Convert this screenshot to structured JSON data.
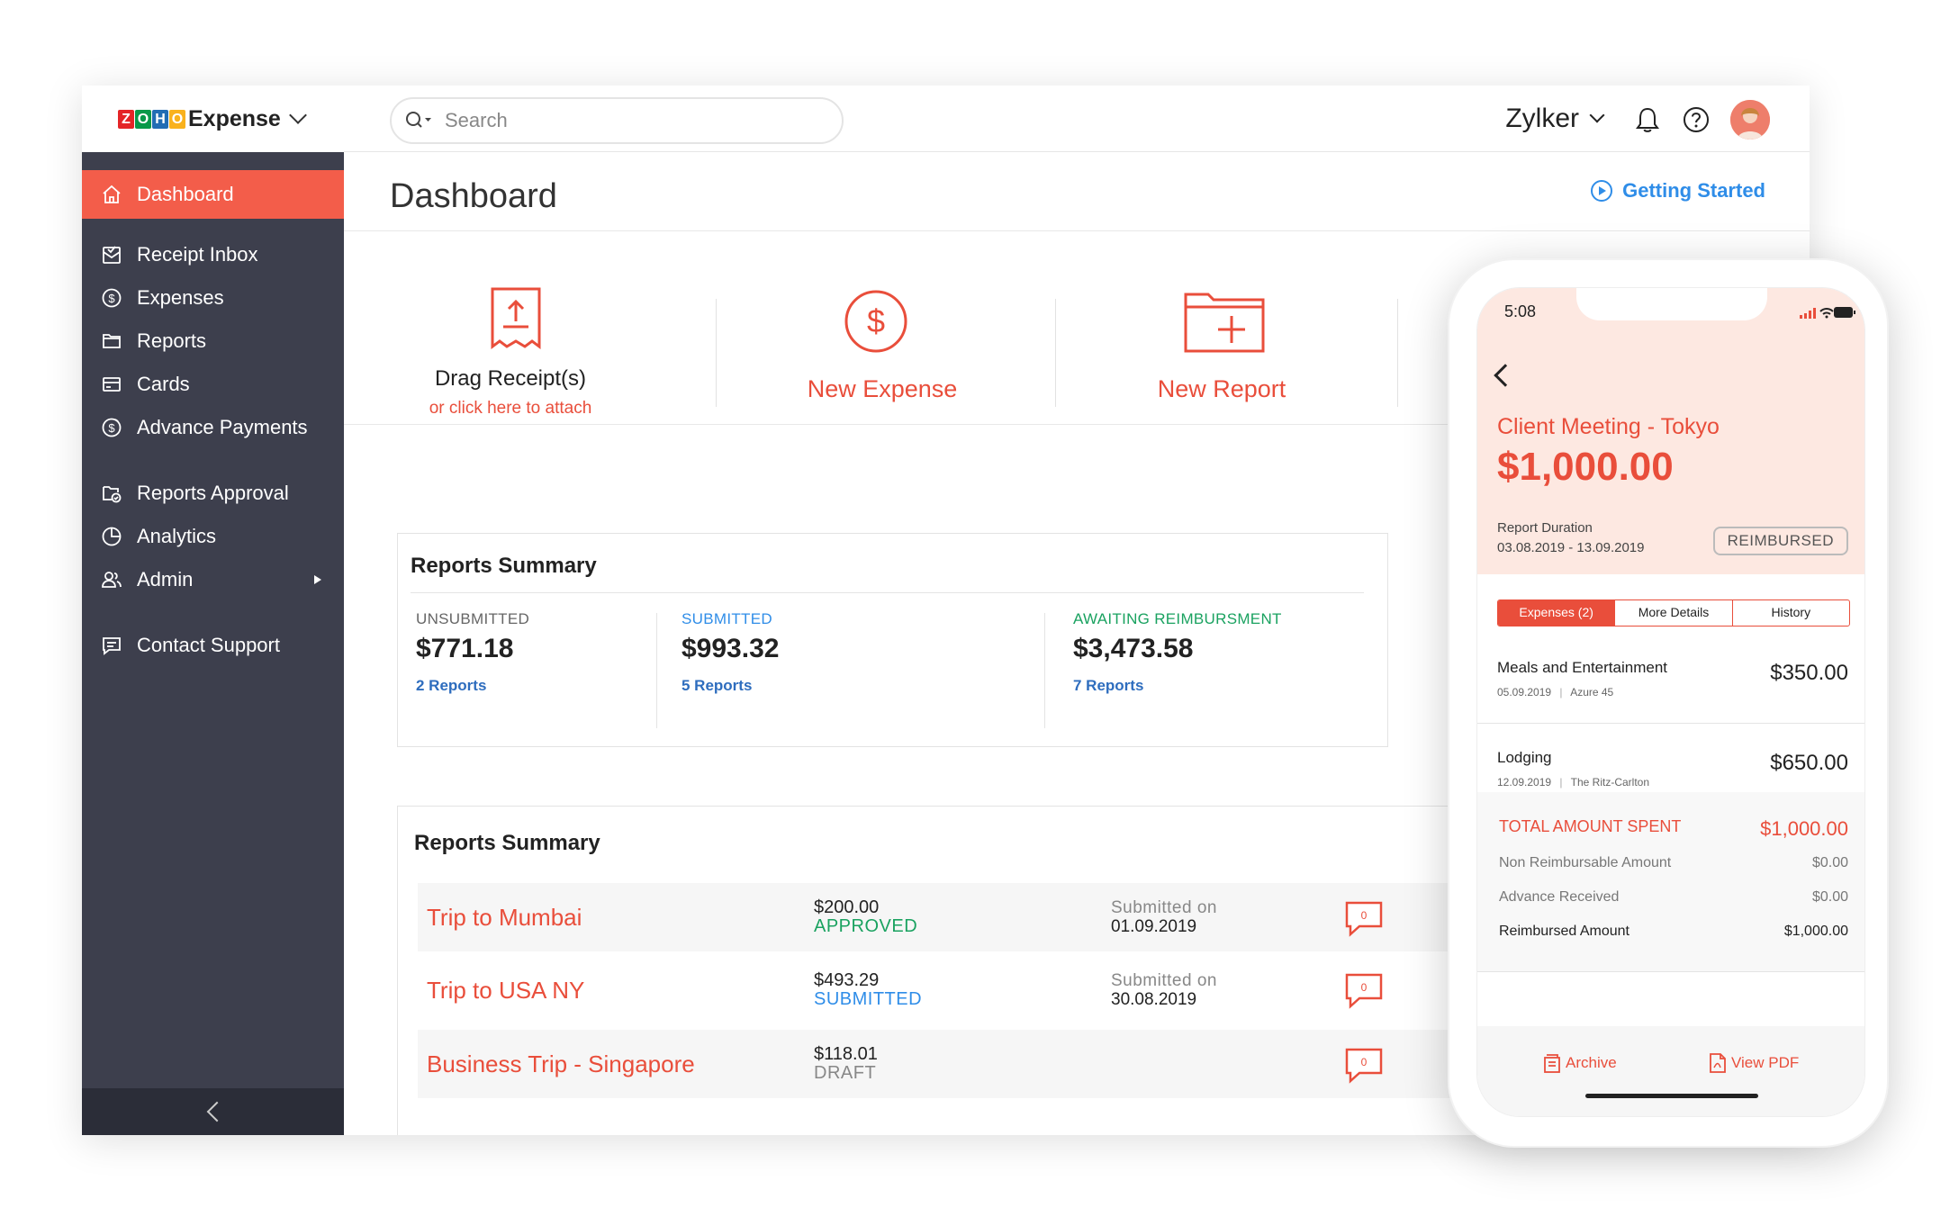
{
  "app": {
    "brand": "Expense",
    "logo_letters": [
      "Z",
      "O",
      "H",
      "O"
    ]
  },
  "search": {
    "placeholder": "Search"
  },
  "topbar": {
    "org_name": "Zylker"
  },
  "sidebar": {
    "items": [
      {
        "label": "Dashboard",
        "icon": "home-icon"
      },
      {
        "label": "Receipt Inbox",
        "icon": "inbox-icon"
      },
      {
        "label": "Expenses",
        "icon": "dollar-circle-icon"
      },
      {
        "label": "Reports",
        "icon": "folder-icon"
      },
      {
        "label": "Cards",
        "icon": "card-icon"
      },
      {
        "label": "Advance Payments",
        "icon": "advance-icon"
      },
      {
        "label": "Reports Approval",
        "icon": "approval-icon"
      },
      {
        "label": "Analytics",
        "icon": "pie-chart-icon"
      },
      {
        "label": "Admin",
        "icon": "users-icon"
      },
      {
        "label": "Contact Support",
        "icon": "chat-icon"
      }
    ]
  },
  "page": {
    "title": "Dashboard",
    "getting_started": "Getting Started"
  },
  "actions": {
    "drag_title": "Drag Receipt(s)",
    "drag_sub": "or click here to attach",
    "new_expense": "New Expense",
    "new_report": "New Report"
  },
  "summary": {
    "title": "Reports Summary",
    "columns": [
      {
        "label": "UNSUBMITTED",
        "value": "$771.18",
        "link": "2 Reports",
        "color": "#666666"
      },
      {
        "label": "SUBMITTED",
        "value": "$993.32",
        "link": "5 Reports",
        "color": "#2f8de8"
      },
      {
        "label": "AWAITING REIMBURSMENT",
        "value": "$3,473.58",
        "link": "7 Reports",
        "color": "#1aa260"
      }
    ]
  },
  "reports": {
    "title": "Reports Summary",
    "submitted_label": "Submitted on",
    "rows": [
      {
        "name": "Trip to Mumbai",
        "amount": "$200.00",
        "status": "APPROVED",
        "status_color": "#1aa260",
        "date": "01.09.2019",
        "comments": "0"
      },
      {
        "name": "Trip to USA NY",
        "amount": "$493.29",
        "status": "SUBMITTED",
        "status_color": "#2f8de8",
        "date": "30.08.2019",
        "comments": "0"
      },
      {
        "name": "Business Trip - Singapore",
        "amount": "$118.01",
        "status": "DRAFT",
        "status_color": "#888888",
        "date": "",
        "comments": "0"
      }
    ]
  },
  "phone": {
    "time": "5:08",
    "title": "Client Meeting - Tokyo",
    "amount": "$1,000.00",
    "duration_label": "Report Duration",
    "duration": "03.08.2019 - 13.09.2019",
    "badge": "REIMBURSED",
    "tabs": [
      "Expenses (2)",
      "More Details",
      "History"
    ],
    "items": [
      {
        "name": "Meals and Entertainment",
        "date": "05.09.2019",
        "merchant": "Azure 45",
        "amount": "$350.00"
      },
      {
        "name": "Lodging",
        "date": "12.09.2019",
        "merchant": "The Ritz-Carlton",
        "amount": "$650.00"
      }
    ],
    "totals": [
      {
        "label": "TOTAL AMOUNT SPENT",
        "value": "$1,000.00"
      },
      {
        "label": "Non Reimbursable Amount",
        "value": "$0.00"
      },
      {
        "label": "Advance Received",
        "value": "$0.00"
      },
      {
        "label": "Reimbursed Amount",
        "value": "$1,000.00"
      }
    ],
    "archive": "Archive",
    "view_pdf": "View PDF"
  },
  "colors": {
    "accent": "#f35d4a",
    "sidebar": "#3d3f4d",
    "link_blue": "#2f8de8",
    "success_green": "#1aa260"
  }
}
